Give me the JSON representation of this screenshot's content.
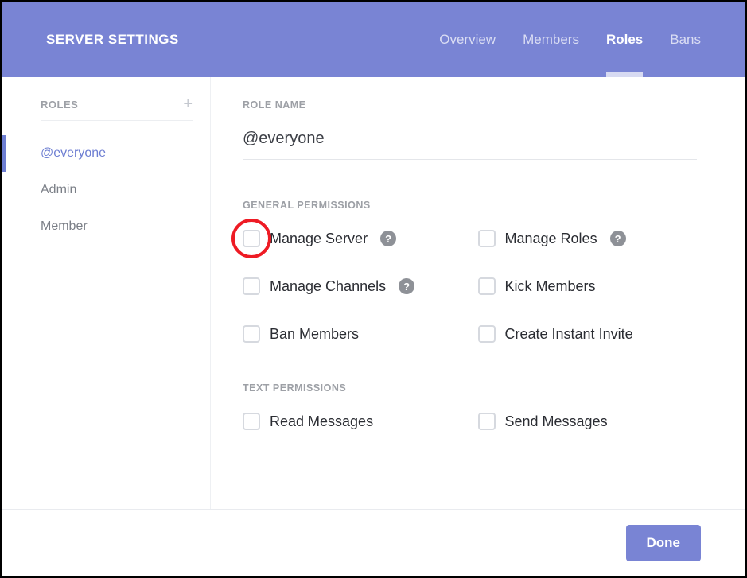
{
  "header": {
    "title": "SERVER SETTINGS",
    "tabs": [
      {
        "label": "Overview",
        "active": false
      },
      {
        "label": "Members",
        "active": false
      },
      {
        "label": "Roles",
        "active": true
      },
      {
        "label": "Bans",
        "active": false
      }
    ]
  },
  "sidebar": {
    "heading": "ROLES",
    "add_icon": "+",
    "items": [
      {
        "label": "@everyone",
        "selected": true
      },
      {
        "label": "Admin",
        "selected": false
      },
      {
        "label": "Member",
        "selected": false
      }
    ]
  },
  "main": {
    "role_name_label": "ROLE NAME",
    "role_name_value": "@everyone",
    "sections": [
      {
        "heading": "GENERAL PERMISSIONS",
        "permissions": [
          {
            "label": "Manage Server",
            "help": true,
            "checked": false,
            "highlight": true
          },
          {
            "label": "Manage Roles",
            "help": true,
            "checked": false
          },
          {
            "label": "Manage Channels",
            "help": true,
            "checked": false
          },
          {
            "label": "Kick Members",
            "help": false,
            "checked": false
          },
          {
            "label": "Ban Members",
            "help": false,
            "checked": false
          },
          {
            "label": "Create Instant Invite",
            "help": false,
            "checked": false
          }
        ]
      },
      {
        "heading": "TEXT PERMISSIONS",
        "permissions": [
          {
            "label": "Read Messages",
            "help": false,
            "checked": false
          },
          {
            "label": "Send Messages",
            "help": false,
            "checked": false
          }
        ]
      }
    ],
    "help_glyph": "?"
  },
  "footer": {
    "done_label": "Done"
  }
}
